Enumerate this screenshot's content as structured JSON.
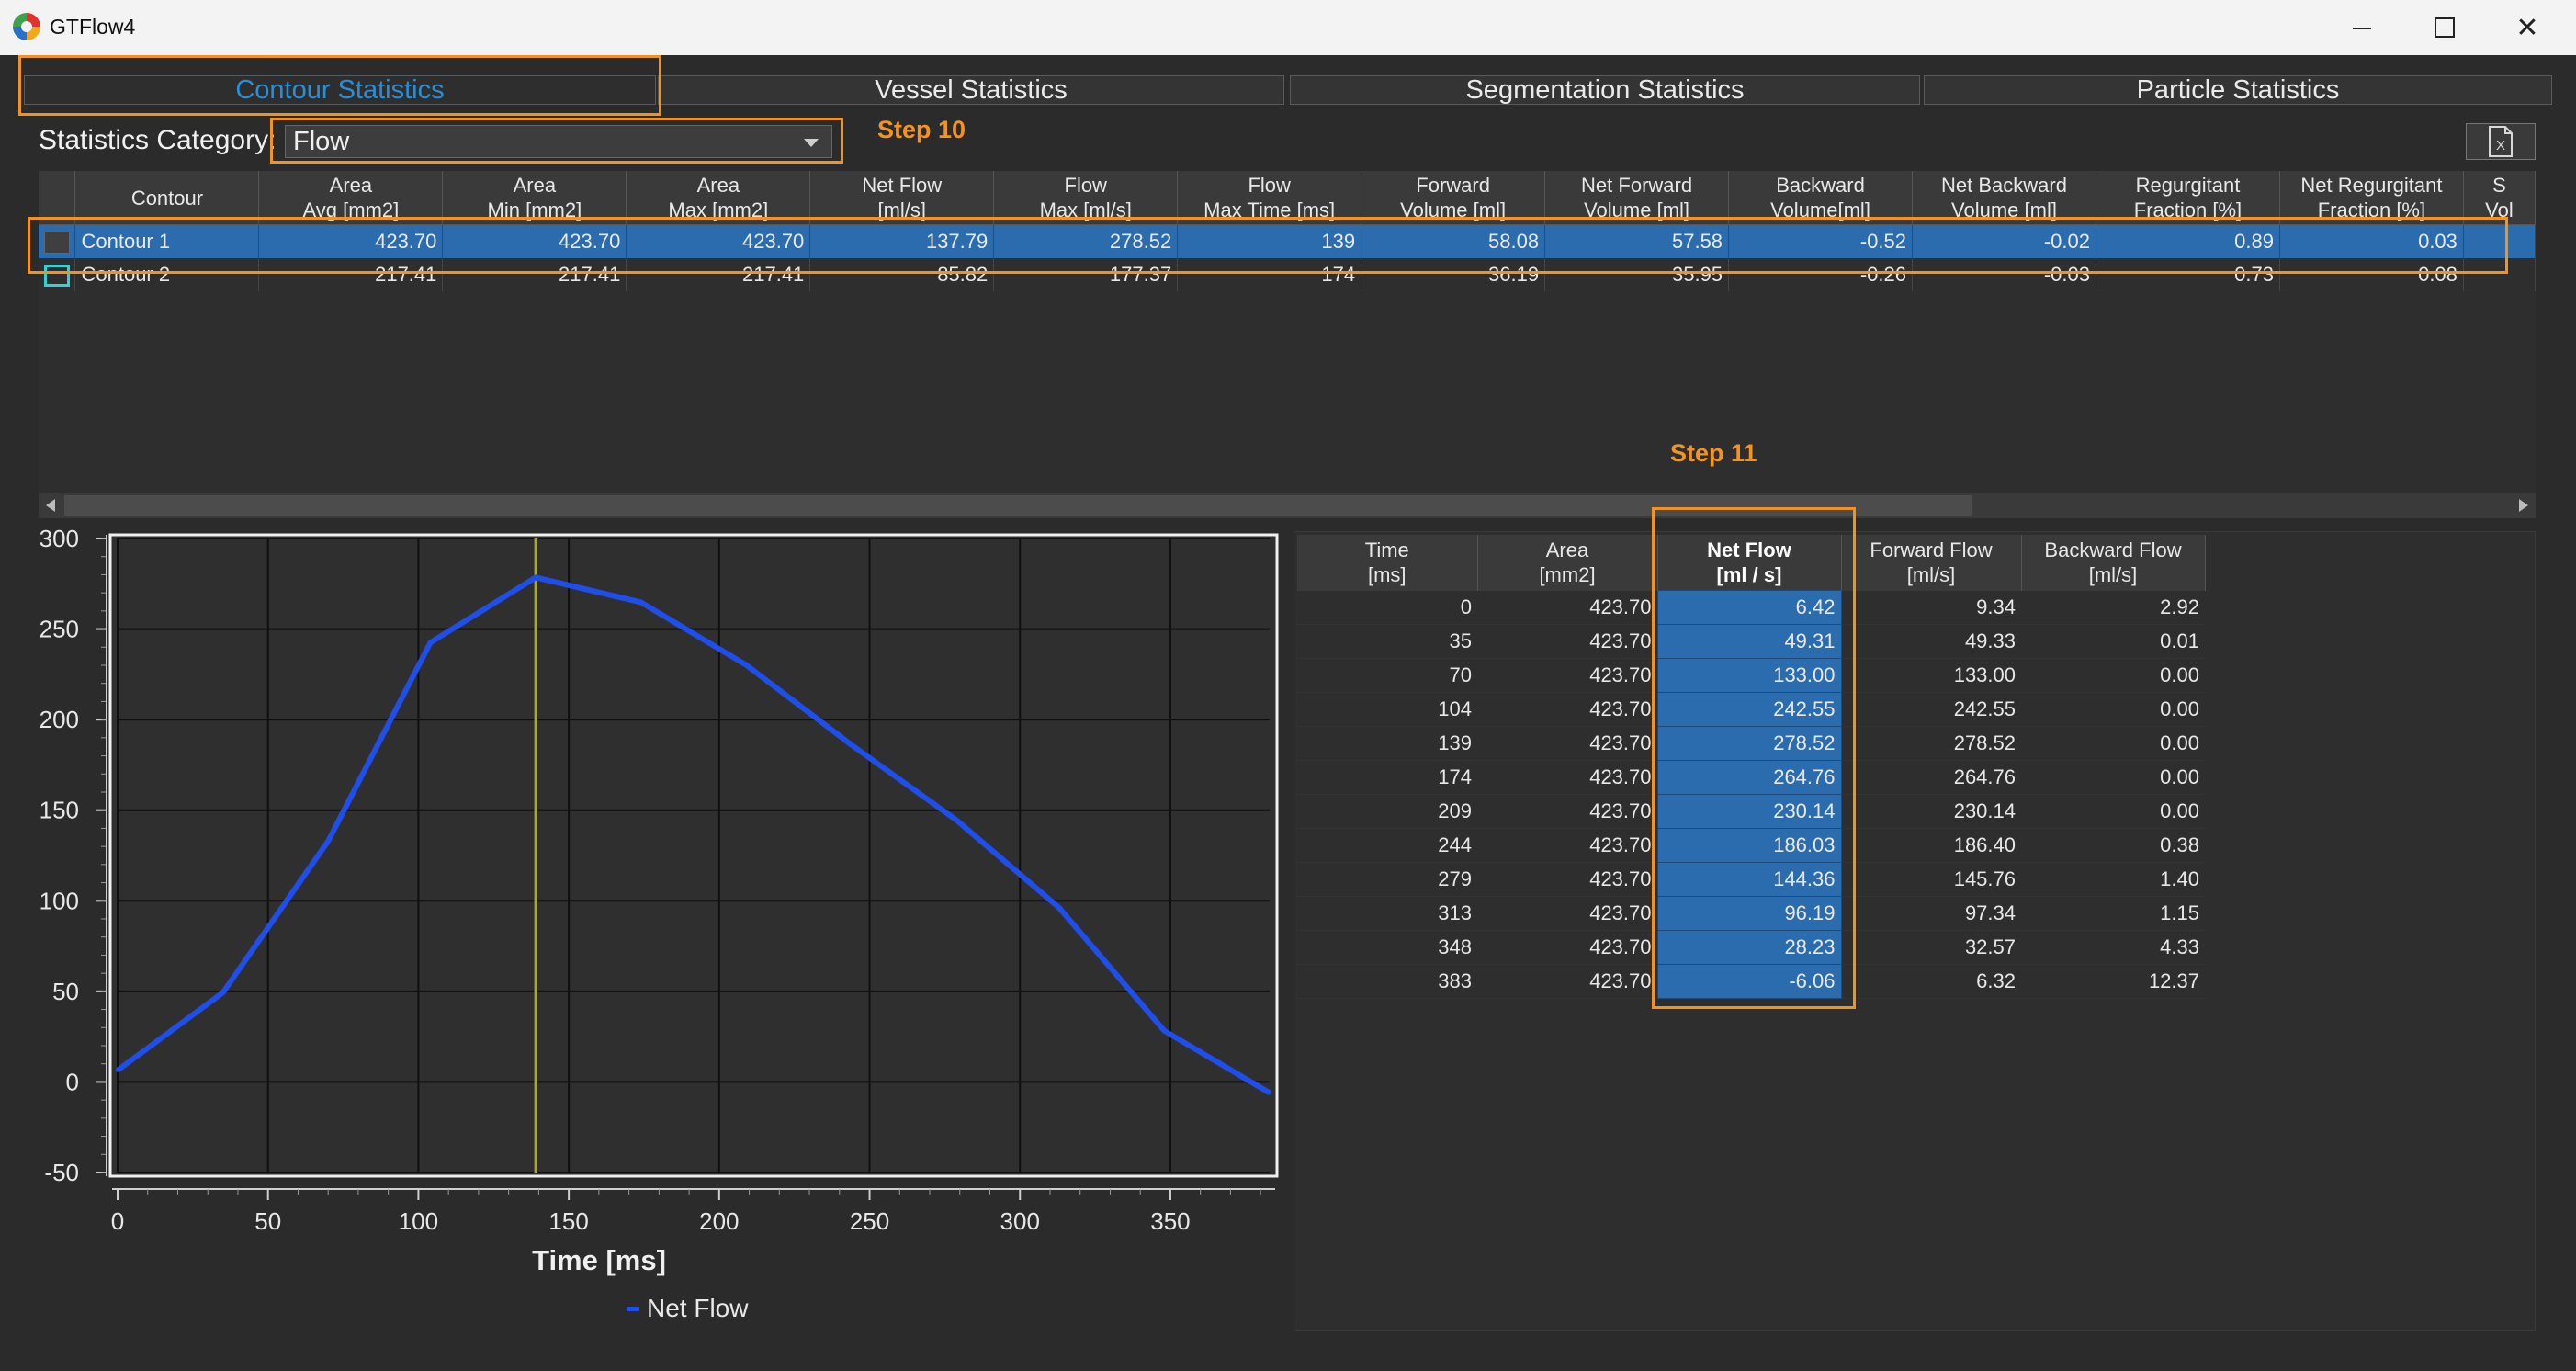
{
  "window": {
    "title": "GTFlow4"
  },
  "tabs": [
    {
      "label": "Contour Statistics",
      "active": true
    },
    {
      "label": "Vessel Statistics",
      "active": false
    },
    {
      "label": "Segmentation Statistics",
      "active": false
    },
    {
      "label": "Particle Statistics",
      "active": false
    }
  ],
  "category": {
    "label": "Statistics Category:",
    "value": "Flow"
  },
  "annotations": {
    "step10": "Step 10",
    "step11": "Step 11"
  },
  "colors": {
    "accent": "#2a8fd6",
    "annotation": "#f09320",
    "selection": "#2a6cae",
    "series": "#1f4ee8",
    "cursor": "#a9a92e",
    "contour1_swatch": "#3f3f3f",
    "contour2_swatch": "#35d0d7"
  },
  "stats_table": {
    "headers": [
      "",
      "Contour",
      "Area\nAvg [mm2]",
      "Area\nMin [mm2]",
      "Area\nMax [mm2]",
      "Net Flow\n[ml/s]",
      "Flow\nMax [ml/s]",
      "Flow\nMax Time [ms]",
      "Forward\nVolume [ml]",
      "Net Forward\nVolume [ml]",
      "Backward\nVolume[ml]",
      "Net Backward\nVolume [ml]",
      "Regurgitant\nFraction [%]",
      "Net Regurgitant\nFraction [%]",
      "S\nVol"
    ],
    "rows": [
      {
        "name": "Contour 1",
        "selected": true,
        "values": [
          "423.70",
          "423.70",
          "423.70",
          "137.79",
          "278.52",
          "139",
          "58.08",
          "57.58",
          "-0.52",
          "-0.02",
          "0.89",
          "0.03",
          ""
        ]
      },
      {
        "name": "Contour 2",
        "selected": false,
        "values": [
          "217.41",
          "217.41",
          "217.41",
          "85.82",
          "177.37",
          "174",
          "36.19",
          "35.95",
          "-0.26",
          "-0.03",
          "0.73",
          "0.08",
          ""
        ]
      }
    ]
  },
  "time_table": {
    "headers": [
      "Time\n[ms]",
      "Area\n[mm2]",
      "Net Flow\n[ml / s]",
      "Forward Flow\n[ml/s]",
      "Backward Flow\n[ml/s]"
    ],
    "rows": [
      [
        "0",
        "423.70",
        "6.42",
        "9.34",
        "2.92"
      ],
      [
        "35",
        "423.70",
        "49.31",
        "49.33",
        "0.01"
      ],
      [
        "70",
        "423.70",
        "133.00",
        "133.00",
        "0.00"
      ],
      [
        "104",
        "423.70",
        "242.55",
        "242.55",
        "0.00"
      ],
      [
        "139",
        "423.70",
        "278.52",
        "278.52",
        "0.00"
      ],
      [
        "174",
        "423.70",
        "264.76",
        "264.76",
        "0.00"
      ],
      [
        "209",
        "423.70",
        "230.14",
        "230.14",
        "0.00"
      ],
      [
        "244",
        "423.70",
        "186.03",
        "186.40",
        "0.38"
      ],
      [
        "279",
        "423.70",
        "144.36",
        "145.76",
        "1.40"
      ],
      [
        "313",
        "423.70",
        "96.19",
        "97.34",
        "1.15"
      ],
      [
        "348",
        "423.70",
        "28.23",
        "32.57",
        "4.33"
      ],
      [
        "383",
        "423.70",
        "-6.06",
        "6.32",
        "12.37"
      ]
    ]
  },
  "chart_data": {
    "type": "line",
    "title": "",
    "xlabel": "Time [ms]",
    "ylabel": "",
    "xlim": [
      0,
      383
    ],
    "ylim": [
      -50,
      300
    ],
    "xticks": [
      0,
      50,
      100,
      150,
      200,
      250,
      300,
      350
    ],
    "yticks": [
      -50,
      0,
      50,
      100,
      150,
      200,
      250,
      300
    ],
    "grid": true,
    "legend": "bottom",
    "cursor_x": 139,
    "series": [
      {
        "name": "Net Flow",
        "x": [
          0,
          35,
          70,
          104,
          139,
          174,
          209,
          244,
          279,
          313,
          348,
          383
        ],
        "y": [
          6.42,
          49.31,
          133.0,
          242.55,
          278.52,
          264.76,
          230.14,
          186.03,
          144.36,
          96.19,
          28.23,
          -6.06
        ]
      }
    ]
  }
}
